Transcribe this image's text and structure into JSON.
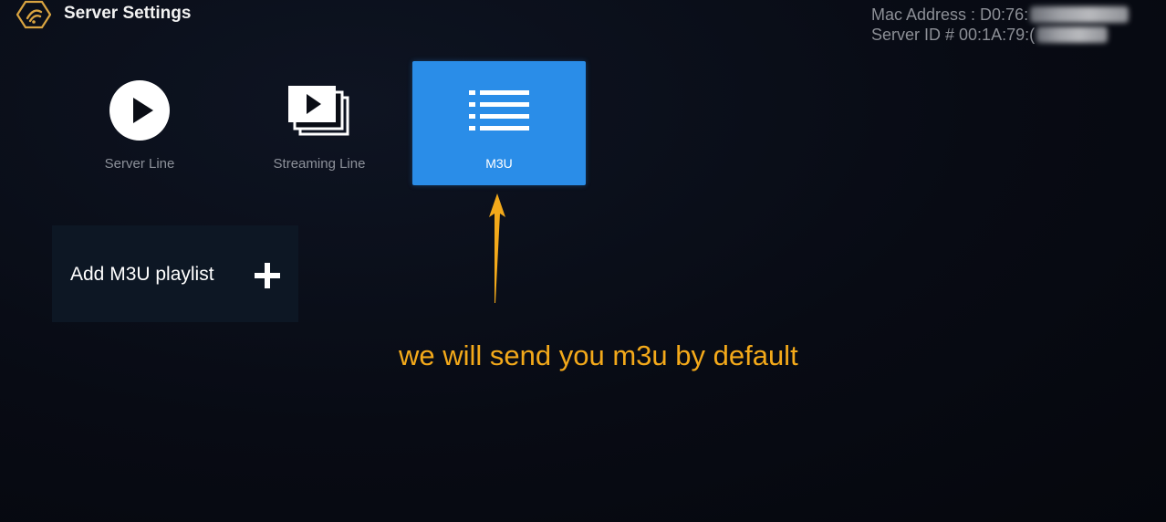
{
  "header": {
    "title": "Server Settings",
    "logo_icon": "brand-logo-icon"
  },
  "device_info": {
    "mac_label": "Mac Address : D0:76:",
    "server_id_label": "Server ID # 00:1A:79:("
  },
  "tiles": [
    {
      "label": "Server Line",
      "icon": "play-circle-icon",
      "selected": false
    },
    {
      "label": "Streaming Line",
      "icon": "video-stack-icon",
      "selected": false
    },
    {
      "label": "M3U",
      "icon": "list-icon",
      "selected": true
    }
  ],
  "add_playlist": {
    "label": "Add M3U playlist",
    "icon": "plus-icon"
  },
  "annotation": {
    "text": "we will send you m3u by default",
    "arrow_icon": "arrow-up-icon"
  },
  "colors": {
    "selected_tile": "#2a8de8",
    "annotation": "#f3a91a",
    "background": "#080b14",
    "panel": "#0d1724"
  }
}
